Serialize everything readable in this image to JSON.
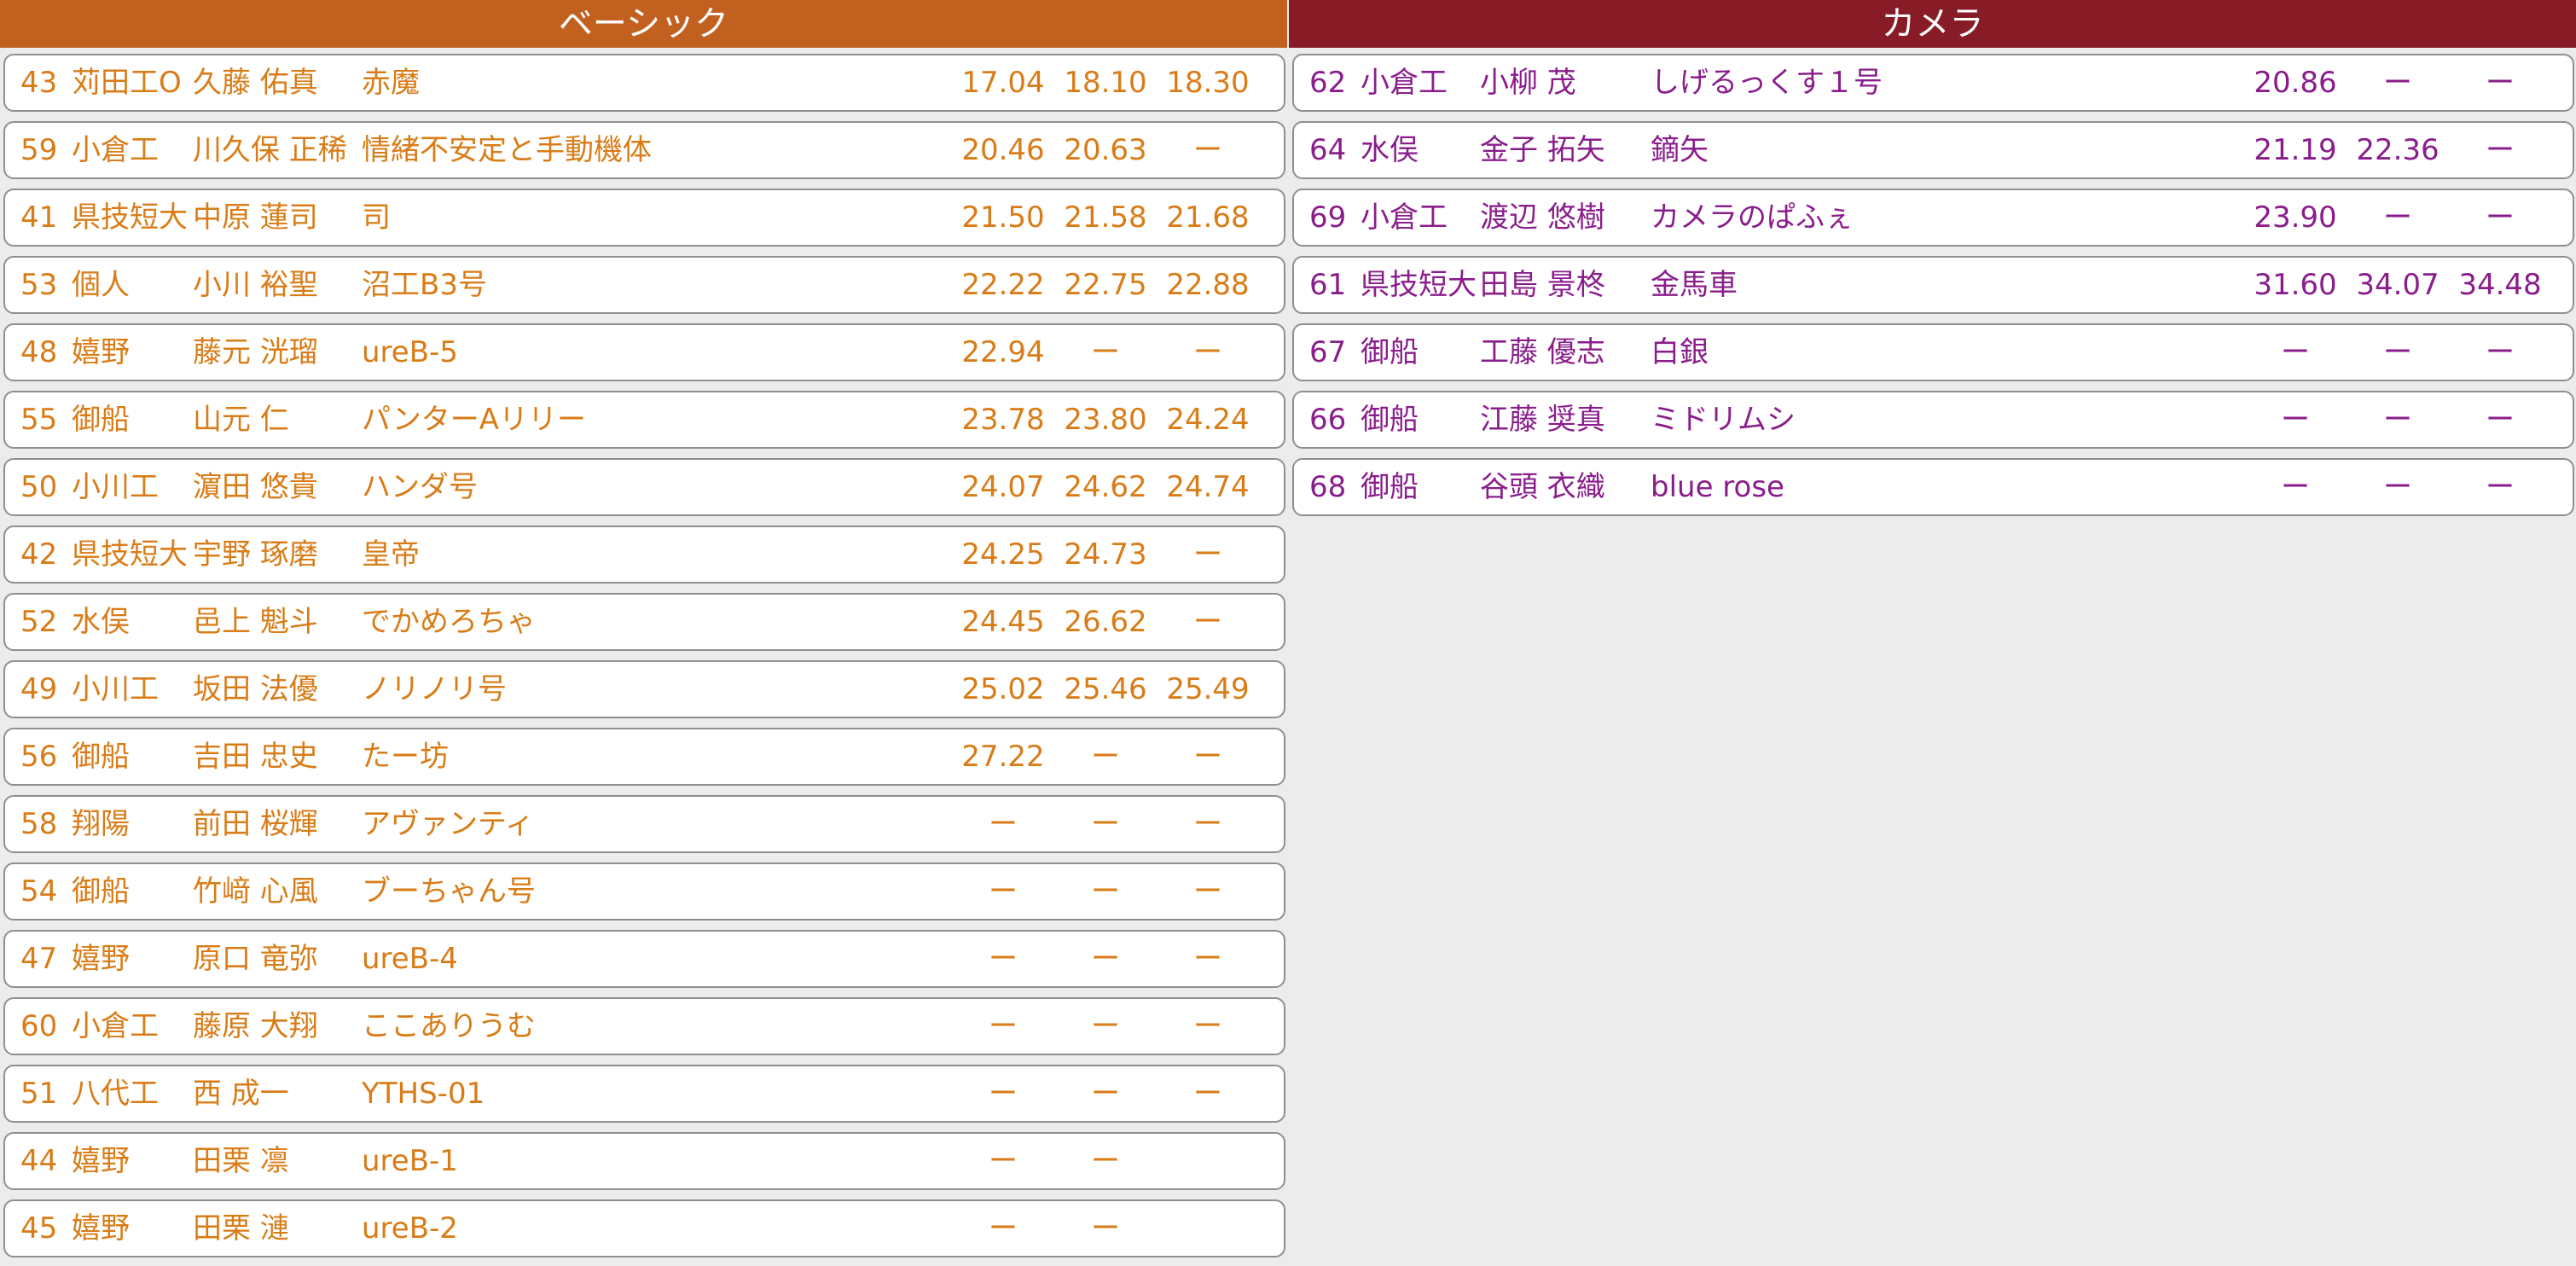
{
  "colors": {
    "basic_header": "#c2611f",
    "camera_header": "#881c26",
    "basic_text": "#d97c17",
    "camera_text": "#8a1d8c",
    "background": "#ececec"
  },
  "basic": {
    "title": "ベーシック",
    "rows": [
      {
        "num": "43",
        "school": "苅田工O",
        "name": "久藤 佑真",
        "machine": "赤魔",
        "t1": "17.04",
        "t2": "18.10",
        "t3": "18.30"
      },
      {
        "num": "59",
        "school": "小倉工",
        "name": "川久保 正稀",
        "machine": "情緒不安定と手動機体",
        "t1": "20.46",
        "t2": "20.63",
        "t3": "ー"
      },
      {
        "num": "41",
        "school": "県技短大",
        "name": "中原 蓮司",
        "machine": "司",
        "t1": "21.50",
        "t2": "21.58",
        "t3": "21.68"
      },
      {
        "num": "53",
        "school": "個人",
        "name": "小川 裕聖",
        "machine": "沼工B3号",
        "t1": "22.22",
        "t2": "22.75",
        "t3": "22.88"
      },
      {
        "num": "48",
        "school": "嬉野",
        "name": "藤元 洸瑠",
        "machine": "ureB-5",
        "t1": "22.94",
        "t2": "ー",
        "t3": "ー"
      },
      {
        "num": "55",
        "school": "御船",
        "name": "山元 仁",
        "machine": "パンターAリリー",
        "t1": "23.78",
        "t2": "23.80",
        "t3": "24.24"
      },
      {
        "num": "50",
        "school": "小川工",
        "name": "濵田 悠貴",
        "machine": "ハンダ号",
        "t1": "24.07",
        "t2": "24.62",
        "t3": "24.74"
      },
      {
        "num": "42",
        "school": "県技短大",
        "name": "宇野 琢磨",
        "machine": "皇帝",
        "t1": "24.25",
        "t2": "24.73",
        "t3": "ー"
      },
      {
        "num": "52",
        "school": "水俣",
        "name": "邑上 魁斗",
        "machine": "でかめろちゃ",
        "t1": "24.45",
        "t2": "26.62",
        "t3": "ー"
      },
      {
        "num": "49",
        "school": "小川工",
        "name": "坂田 法優",
        "machine": "ノリノリ号",
        "t1": "25.02",
        "t2": "25.46",
        "t3": "25.49"
      },
      {
        "num": "56",
        "school": "御船",
        "name": "吉田 忠史",
        "machine": "たー坊",
        "t1": "27.22",
        "t2": "ー",
        "t3": "ー"
      },
      {
        "num": "58",
        "school": "翔陽",
        "name": "前田 桜輝",
        "machine": "アヴァンティ",
        "t1": "ー",
        "t2": "ー",
        "t3": "ー"
      },
      {
        "num": "54",
        "school": "御船",
        "name": "竹﨑 心風",
        "machine": "ブーちゃん号",
        "t1": "ー",
        "t2": "ー",
        "t3": "ー"
      },
      {
        "num": "47",
        "school": "嬉野",
        "name": "原口 竜弥",
        "machine": "ureB-4",
        "t1": "ー",
        "t2": "ー",
        "t3": "ー"
      },
      {
        "num": "60",
        "school": "小倉工",
        "name": "藤原 大翔",
        "machine": "ここありうむ",
        "t1": "ー",
        "t2": "ー",
        "t3": "ー"
      },
      {
        "num": "51",
        "school": "八代工",
        "name": "西 成一",
        "machine": "YTHS-01",
        "t1": "ー",
        "t2": "ー",
        "t3": "ー"
      },
      {
        "num": "44",
        "school": "嬉野",
        "name": "田栗 凛",
        "machine": "ureB-1",
        "t1": "ー",
        "t2": "ー",
        "t3": ""
      },
      {
        "num": "45",
        "school": "嬉野",
        "name": "田栗 漣",
        "machine": "ureB-2",
        "t1": "ー",
        "t2": "ー",
        "t3": ""
      }
    ]
  },
  "camera": {
    "title": "カメラ",
    "rows": [
      {
        "num": "62",
        "school": "小倉工",
        "name": "小柳 茂",
        "machine": "しげるっくす１号",
        "t1": "20.86",
        "t2": "ー",
        "t3": "ー"
      },
      {
        "num": "64",
        "school": "水俣",
        "name": "金子 拓矢",
        "machine": "鏑矢",
        "t1": "21.19",
        "t2": "22.36",
        "t3": "ー"
      },
      {
        "num": "69",
        "school": "小倉工",
        "name": "渡辺 悠樹",
        "machine": "カメラのぱふぇ",
        "t1": "23.90",
        "t2": "ー",
        "t3": "ー"
      },
      {
        "num": "61",
        "school": "県技短大",
        "name": "田島 景柊",
        "machine": "金馬車",
        "t1": "31.60",
        "t2": "34.07",
        "t3": "34.48"
      },
      {
        "num": "67",
        "school": "御船",
        "name": "工藤 優志",
        "machine": "白銀",
        "t1": "ー",
        "t2": "ー",
        "t3": "ー"
      },
      {
        "num": "66",
        "school": "御船",
        "name": "江藤 奨真",
        "machine": "ミドリムシ",
        "t1": "ー",
        "t2": "ー",
        "t3": "ー"
      },
      {
        "num": "68",
        "school": "御船",
        "name": "谷頭 衣織",
        "machine": "blue rose",
        "t1": "ー",
        "t2": "ー",
        "t3": "ー"
      }
    ]
  }
}
